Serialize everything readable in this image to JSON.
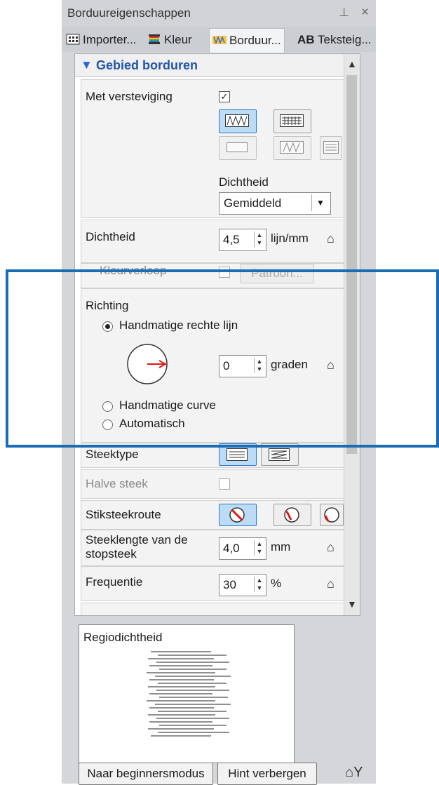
{
  "panel": {
    "title": "Borduureigenschappen",
    "pin_icon": "pin-icon",
    "close_icon": "close-icon"
  },
  "tabs": [
    {
      "label": "Importer...",
      "icon": "import-icon"
    },
    {
      "label": "Kleur",
      "icon": "color-spool-icon"
    },
    {
      "label": "Borduur...",
      "icon": "embroidery-icon",
      "active": true
    },
    {
      "label": "Teksteig...",
      "icon_text": "AB"
    }
  ],
  "section": {
    "title": "Gebied borduren",
    "toggle_glyph": "▼"
  },
  "versteviging": {
    "label": "Met versteviging",
    "checked": true,
    "dichtheid_label": "Dichtheid",
    "dichtheid_value": "Gemiddeld"
  },
  "dichtheid": {
    "label": "Dichtheid",
    "value": "4,5",
    "unit": "lijn/mm"
  },
  "kleurverloop": {
    "label": "Kleurverloop",
    "button": "Patroon..."
  },
  "richting": {
    "label": "Richting",
    "options": [
      "Handmatige rechte lijn",
      "Handmatige curve",
      "Automatisch"
    ],
    "selected": "Handmatige rechte lijn",
    "angle_value": "0",
    "angle_unit": "graden"
  },
  "steektype": {
    "label": "Steektype"
  },
  "halve_steek": {
    "label": "Halve steek",
    "checked": false
  },
  "stiksteekroute": {
    "label": "Stiksteekroute"
  },
  "steeklengte": {
    "label_line1": "Steeklengte van de",
    "label_line2": "stopsteek",
    "value": "4,0",
    "unit": "mm"
  },
  "frequentie": {
    "label": "Frequentie",
    "value": "30",
    "unit": "%"
  },
  "preview": {
    "title": "Regiodichtheid"
  },
  "footer": {
    "beginner_button": "Naar beginnersmodus",
    "hint_button": "Hint verbergen"
  },
  "colors": {
    "accent": "#2a66d6",
    "highlight_frame": "#1a6db4",
    "arrow": "#e01818"
  }
}
